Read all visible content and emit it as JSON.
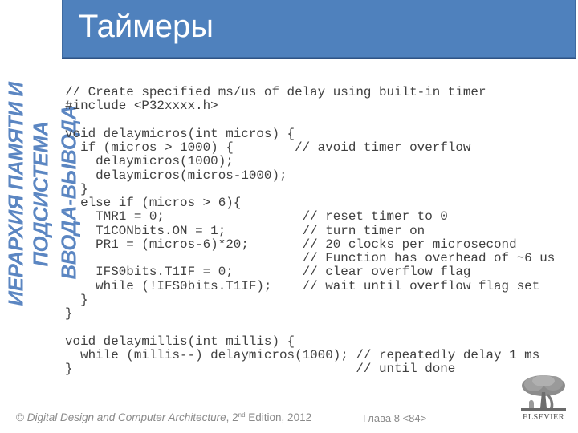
{
  "slide": {
    "title": "Таймеры",
    "side_title_lines": [
      "ИЕРАРХИЯ ПАМЯТИ И",
      "ПОДСИСТЕМА",
      "ВВОДА-ВЫВОДА"
    ],
    "code_lines": [
      "// Create specified ms/us of delay using built-in timer",
      "#include <P32xxxx.h>",
      "",
      "void delaymicros(int micros) {",
      "  if (micros > 1000) {        // avoid timer overflow",
      "    delaymicros(1000);",
      "    delaymicros(micros-1000);",
      "  }",
      "  else if (micros > 6){",
      "    TMR1 = 0;                  // reset timer to 0",
      "    T1CONbits.ON = 1;          // turn timer on",
      "    PR1 = (micros-6)*20;       // 20 clocks per microsecond",
      "                               // Function has overhead of ~6 us",
      "    IFS0bits.T1IF = 0;         // clear overflow flag",
      "    while (!IFS0bits.T1IF);    // wait until overflow flag set",
      "  }",
      "}",
      "",
      "void delaymillis(int millis) {",
      "  while (millis--) delaymicros(1000); // repeatedly delay 1 ms",
      "}                                     // until done"
    ]
  },
  "footer": {
    "copyright_symbol": "©",
    "book_title": "Digital Design and Computer Architecture",
    "edition_number": "2",
    "edition_suffix": "nd",
    "edition_rest": " Edition, 2012",
    "chapter_page": "Глава 8 <84>",
    "publisher_logo_label": "ELSEVIER"
  },
  "colors": {
    "title_bar": "#4f81bd",
    "side_title": "#5b86c2",
    "code_text": "#404040",
    "footer_text": "#8a8a8a"
  }
}
